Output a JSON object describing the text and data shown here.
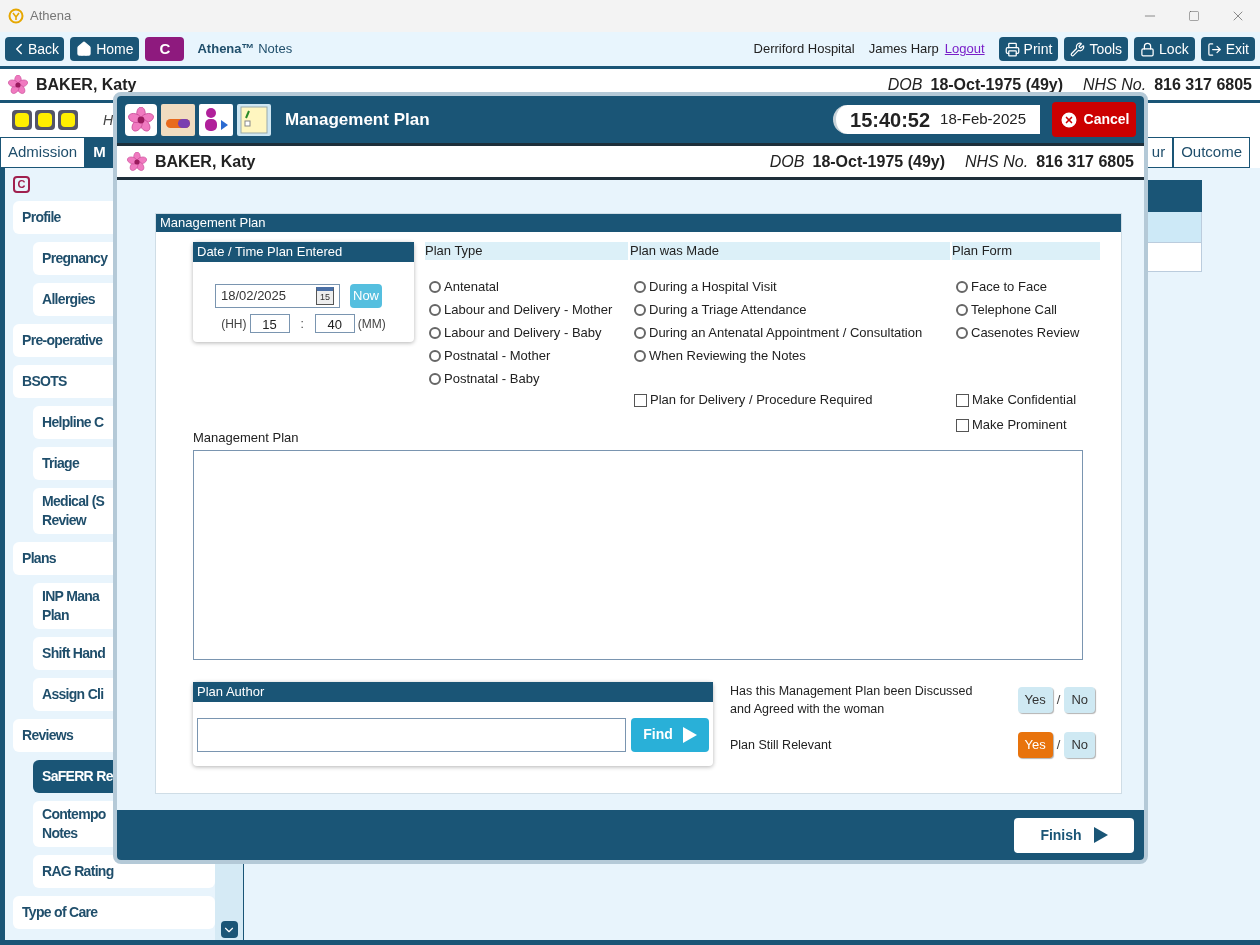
{
  "window": {
    "title": "Athena"
  },
  "toolbar": {
    "back": "Back",
    "home": "Home",
    "badge": "C",
    "app_name": "Athena™",
    "app_sub": "Notes",
    "hospital": "Derriford Hospital",
    "user": "James Harp",
    "logout": "Logout",
    "buttons": [
      {
        "kind": "print",
        "label": "Print"
      },
      {
        "kind": "tools",
        "label": "Tools"
      },
      {
        "kind": "lock",
        "label": "Lock"
      },
      {
        "kind": "exit",
        "label": "Exit"
      }
    ]
  },
  "patient": {
    "name": "BAKER, Katy",
    "dob_label": "DOB",
    "dob": "18-Oct-1975 (49y)",
    "nhs_label": "NHS No.",
    "nhs": "816 317 6805"
  },
  "help_row": {
    "text": "H"
  },
  "tabs": [
    {
      "label": "Admission",
      "selected": false
    },
    {
      "label": "M",
      "selected": true
    },
    {
      "label": "ur",
      "selected": false
    },
    {
      "label": "Outcome",
      "selected": false
    }
  ],
  "sidebar": {
    "badge": "C",
    "items": [
      {
        "lines": [
          "Profile"
        ],
        "selected": false,
        "children": [
          {
            "lines": [
              "Pregnancy"
            ],
            "selected": false
          },
          {
            "lines": [
              "Allergies"
            ],
            "selected": false
          }
        ]
      },
      {
        "lines": [
          "Pre-operative"
        ],
        "selected": false
      },
      {
        "lines": [
          "BSOTS"
        ],
        "selected": false,
        "children": [
          {
            "lines": [
              "Helpline C"
            ],
            "selected": false
          },
          {
            "lines": [
              "Triage"
            ],
            "selected": false
          },
          {
            "lines": [
              "Medical (S",
              "Review"
            ],
            "selected": false
          }
        ]
      },
      {
        "lines": [
          "Plans"
        ],
        "selected": false,
        "children": [
          {
            "lines": [
              "INP Mana",
              "Plan"
            ],
            "selected": false
          },
          {
            "lines": [
              "Shift Hand"
            ],
            "selected": false
          },
          {
            "lines": [
              "Assign Cli"
            ],
            "selected": false
          }
        ]
      },
      {
        "lines": [
          "Reviews"
        ],
        "selected": false,
        "children": [
          {
            "lines": [
              "SaFERR Re"
            ],
            "selected": true
          },
          {
            "lines": [
              "Contempo",
              "Notes"
            ],
            "selected": false
          },
          {
            "lines": [
              "RAG Rating"
            ],
            "selected": false
          }
        ]
      },
      {
        "lines": [
          "Type of Care"
        ],
        "selected": false
      }
    ]
  },
  "dialog": {
    "title": "Management Plan",
    "time": "15:40:52",
    "date": "18-Feb-2025",
    "cancel": "Cancel",
    "patient": {
      "name": "BAKER, Katy",
      "dob_label": "DOB",
      "dob": "18-Oct-1975 (49y)",
      "nhs_label": "NHS No.",
      "nhs": "816 317 6805"
    },
    "section_title": "Management Plan",
    "date_panel": {
      "title": "Date / Time Plan Entered",
      "date": "18/02/2025",
      "calendar_day": "15",
      "now": "Now",
      "hh_label": "(HH)",
      "hh": "15",
      "sep": ":",
      "mm": "40",
      "mm_label": "(MM)"
    },
    "groups": [
      {
        "title": "Plan Type",
        "options": [
          {
            "label": "Antenatal",
            "selected": false
          },
          {
            "label": "Labour and Delivery - Mother",
            "selected": false
          },
          {
            "label": "Labour and Delivery - Baby",
            "selected": false
          },
          {
            "label": "Postnatal - Mother",
            "selected": false
          },
          {
            "label": "Postnatal - Baby",
            "selected": false
          }
        ]
      },
      {
        "title": "Plan was Made",
        "options": [
          {
            "label": "During a Hospital Visit",
            "selected": false
          },
          {
            "label": "During a Triage Attendance",
            "selected": false
          },
          {
            "label": "During an Antenatal Appointment / Consultation",
            "selected": false
          },
          {
            "label": "When Reviewing the Notes",
            "selected": false
          }
        ],
        "checks": [
          {
            "label": "Plan for Delivery / Procedure Required",
            "checked": false
          }
        ]
      },
      {
        "title": "Plan Form",
        "options": [
          {
            "label": "Face to Face",
            "selected": false
          },
          {
            "label": "Telephone Call",
            "selected": false
          },
          {
            "label": "Casenotes Review",
            "selected": false
          }
        ],
        "checks": [
          {
            "label": "Make Confidential",
            "checked": false
          },
          {
            "label": "Make Prominent",
            "checked": false
          }
        ]
      }
    ],
    "notes_label": "Management Plan",
    "author": {
      "title": "Plan Author",
      "find": "Find"
    },
    "questions": [
      {
        "text": "Has this Management Plan been Discussed and Agreed with the woman",
        "sep": "/",
        "options": [
          {
            "label": "Yes",
            "selected": false
          },
          {
            "label": "No",
            "selected": false
          }
        ]
      },
      {
        "text": "Plan Still Relevant",
        "sep": "/",
        "options": [
          {
            "label": "Yes",
            "selected": true
          },
          {
            "label": "No",
            "selected": false
          }
        ]
      }
    ],
    "finish": "Finish"
  }
}
